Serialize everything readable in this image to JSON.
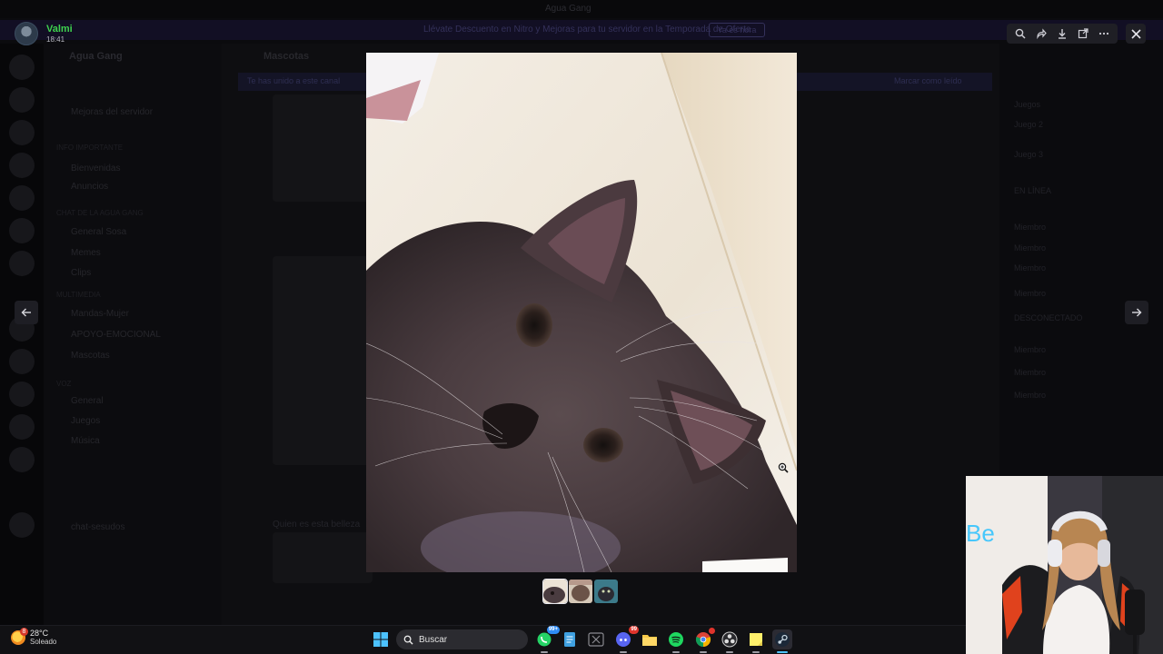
{
  "background": {
    "window_title": "Agua Gang",
    "banner": {
      "text": "Llévate Descuento en Nitro y Mejoras para tu servidor en la Temporada de Oferta",
      "button": "Ya es hora"
    },
    "server_name": "Agua Gang",
    "channels": [
      {
        "label": "Mejoras del servidor",
        "category": false
      },
      {
        "label": "INFO IMPORTANTE",
        "category": true
      },
      {
        "label": "Bienvenidas",
        "category": false
      },
      {
        "label": "Anuncios",
        "category": false
      },
      {
        "label": "CHAT DE LA AGUA GANG",
        "category": true
      },
      {
        "label": "General Sosa",
        "category": false
      },
      {
        "label": "Memes",
        "category": false
      },
      {
        "label": "Clips",
        "category": false
      },
      {
        "label": "MULTIMEDIA",
        "category": true
      },
      {
        "label": "Mandas-Mujer",
        "category": false
      },
      {
        "label": "APOYO-EMOCIONAL",
        "category": false
      },
      {
        "label": "Mascotas",
        "category": false
      },
      {
        "label": "VOZ",
        "category": true
      },
      {
        "label": "General",
        "category": false
      },
      {
        "label": "Juegos",
        "category": false
      },
      {
        "label": "Música",
        "category": false
      },
      {
        "label": "chat-sesudos",
        "category": false
      }
    ],
    "chat_header": "Mascotas",
    "chat_notice": "Te has unido a este canal",
    "chat_notice_action": "Marcar como leído",
    "chat_line": "Quien es esta belleza",
    "members": [
      "Juegos",
      "Juego 2",
      "Juego 3",
      "EN LÍNEA",
      "Miembro",
      "Miembro",
      "Miembro",
      "Miembro",
      "DESCONECTADO",
      "Miembro",
      "Miembro",
      "Miembro"
    ]
  },
  "viewer": {
    "user_name": "Valmi",
    "time": "18:41",
    "toolbar": [
      {
        "name": "zoom-icon"
      },
      {
        "name": "forward-icon"
      },
      {
        "name": "download-icon"
      },
      {
        "name": "open-external-icon"
      },
      {
        "name": "more-icon"
      }
    ],
    "close_icon": "close-icon",
    "prev_icon": "arrow-left-icon",
    "next_icon": "arrow-right-icon",
    "thumbnails": [
      {
        "name": "thumb-cat",
        "active": true
      },
      {
        "name": "thumb-pet-2",
        "active": false
      },
      {
        "name": "thumb-pet-3",
        "active": false
      }
    ]
  },
  "taskbar": {
    "weather": {
      "temp": "28°C",
      "desc": "Soleado",
      "badge": "8"
    },
    "search_placeholder": "Buscar",
    "apps": [
      {
        "name": "windows-start-icon"
      },
      {
        "name": "whatsapp-icon",
        "badge": "99+"
      },
      {
        "name": "notepad-icon"
      },
      {
        "name": "xbox-icon"
      },
      {
        "name": "discord-icon",
        "badge": "99"
      },
      {
        "name": "file-explorer-icon"
      },
      {
        "name": "spotify-icon"
      },
      {
        "name": "chrome-icon"
      },
      {
        "name": "obs-icon"
      },
      {
        "name": "sticky-notes-icon"
      },
      {
        "name": "steam-icon"
      }
    ]
  },
  "colors": {
    "username_green": "#3ed14e",
    "viewer_button_bg": "#1f1f25",
    "taskbar_bg": "#111114"
  }
}
